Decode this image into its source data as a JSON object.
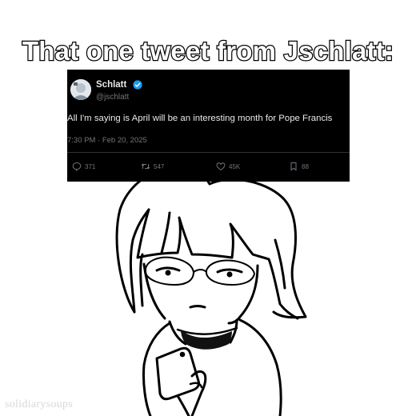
{
  "meme": {
    "caption": "That one tweet from Jschlatt:",
    "watermark": "solidiarysoups"
  },
  "tweet": {
    "display_name": "Schlatt",
    "handle": "@jschlatt",
    "verified": true,
    "text": "All I'm saying is April will be an interesting month for Pope Francis",
    "timestamp": "7:30 PM · Feb 20, 2025",
    "actions": {
      "replies": "371",
      "reposts": "547",
      "likes": "45K",
      "bookmarks": "88"
    },
    "icons": [
      "reply-icon",
      "repost-icon",
      "like-icon",
      "bookmark-icon"
    ],
    "colors": {
      "background": "#000000",
      "text": "#e7e9ea",
      "muted": "#71767b",
      "verified": "#1d9bf0"
    }
  }
}
